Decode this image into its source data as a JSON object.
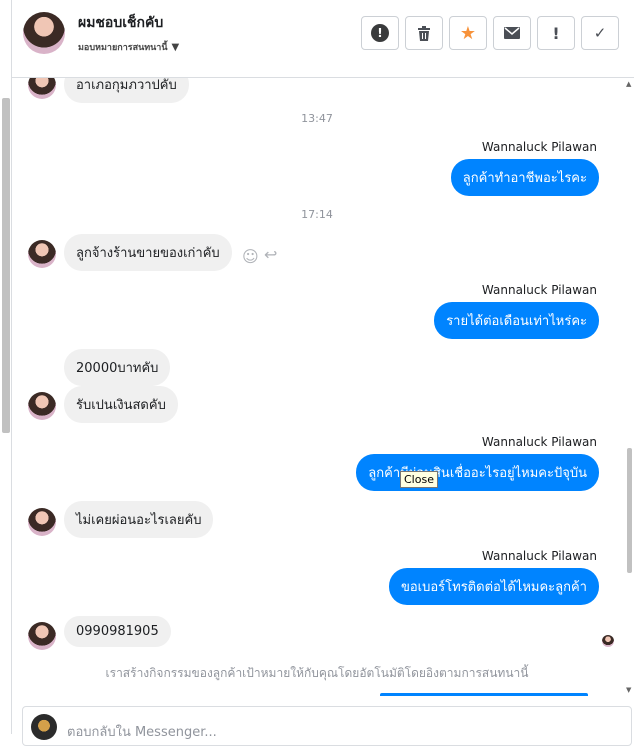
{
  "header": {
    "name": "ผมชอบเช็กคับ",
    "label": "มอบหมายการสนทนานี้",
    "actions": [
      {
        "name": "alert-circle-icon",
        "glyph": "!"
      },
      {
        "name": "trash-icon",
        "glyph": "🗑"
      },
      {
        "name": "star-icon",
        "glyph": "★"
      },
      {
        "name": "envelope-icon",
        "glyph": "✉"
      },
      {
        "name": "exclamation-icon",
        "glyph": "!"
      },
      {
        "name": "check-icon",
        "glyph": "✓"
      }
    ]
  },
  "messages": {
    "m0": "อาเภอกุมภวาปคับ",
    "t1": "13:47",
    "s1": "Wannaluck Pilawan",
    "m1": "ลูกค้าทำอาชีพอะไรคะ",
    "t2": "17:14",
    "m2": "ลูกจ้างร้านขายของเก่าคับ",
    "s2": "Wannaluck Pilawan",
    "m3": "รายได้ต่อเดือนเท่าไหร่คะ",
    "m4": "20000บาทคับ",
    "m5": "รับเปนเงินสดคับ",
    "s3": "Wannaluck Pilawan",
    "m6": "ลูกค้ามีผ่อนสินเชื่ออะไรอยู่ไหมคะปัจุบัน",
    "tooltip": "Close",
    "m7": "ไม่เคยผ่อนอะไรเลยคับ",
    "s4": "Wannaluck Pilawan",
    "m8": "ขอเบอร์โทรติดต่อได้ไหมคะลูกค้า",
    "m9": "0990981905"
  },
  "notice": "เราสร้างกิจกรรมของลูกค้าเป้าหมายให้กับคุณโดยอัตโนมัติโดยอิงตามการสนทนานี้",
  "composer": {
    "placeholder": "ตอบกลับใน Messenger..."
  },
  "colors": {
    "outgoing": "#0084ff",
    "incoming": "#f0f0f0",
    "star": "#f7923a"
  }
}
